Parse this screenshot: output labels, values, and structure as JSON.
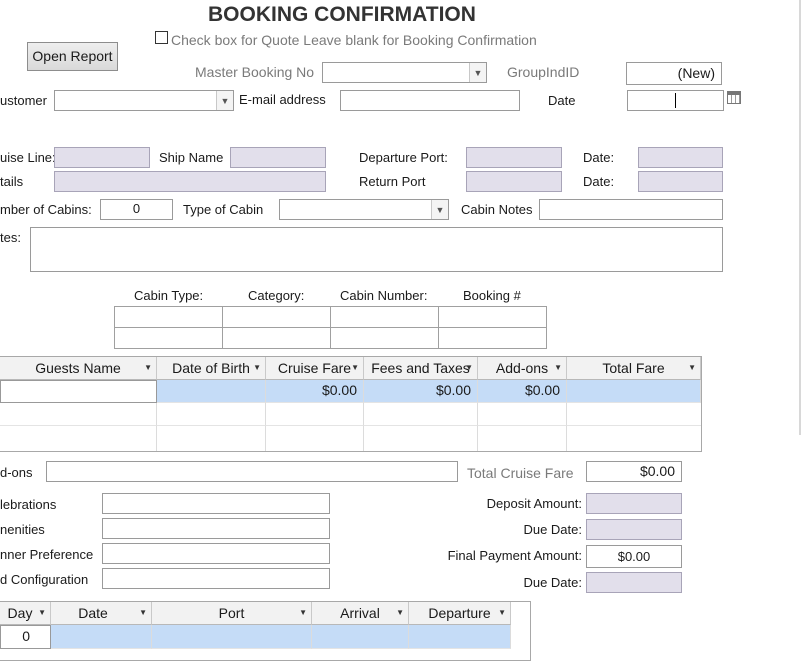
{
  "title": "BOOKING CONFIRMATION",
  "quote_checkbox_label": "Check box for Quote Leave blank for Booking Confirmation",
  "open_report_label": "Open Report",
  "master_booking_label": "Master Booking No",
  "group_id_label": "GroupIndID",
  "group_id_value": "(New)",
  "customer_label": "ustomer",
  "email_label": "E-mail address",
  "date_label": "Date",
  "cruise_line_label": "uise Line:",
  "ship_name_label": "Ship Name",
  "departure_port_label": "Departure Port:",
  "departure_date_label": "Date:",
  "details_label": "tails",
  "return_port_label": "Return Port",
  "return_date_label": "Date:",
  "num_cabins_label": "mber of Cabins:",
  "num_cabins_value": "0",
  "cabin_type_label": "Type of Cabin",
  "cabin_notes_label": "Cabin Notes",
  "notes_label": "tes:",
  "cabin_table": {
    "headers": [
      "Cabin Type:",
      "Category:",
      "Cabin Number:",
      "Booking #"
    ]
  },
  "guests_grid": {
    "headers": [
      "Guests Name",
      "Date of Birth",
      "Cruise Fare",
      "Fees and Taxes",
      "Add-ons",
      "Total Fare"
    ],
    "row1": [
      "",
      "",
      "$0.00",
      "$0.00",
      "$0.00",
      ""
    ]
  },
  "addons_label": "d-ons",
  "total_cruise_fare_label": "Total Cruise Fare",
  "total_cruise_fare_value": "$0.00",
  "celebrations_label": "lebrations",
  "amenities_label": "nenities",
  "dinner_pref_label": "nner Preference",
  "bed_config_label": "d Configuration",
  "deposit_amount_label": "Deposit Amount:",
  "due_date_label_1": "Due Date:",
  "final_payment_label": "Final Payment Amount:",
  "final_payment_value": "$0.00",
  "due_date_label_2": "Due Date:",
  "itinerary_grid": {
    "headers": [
      "Day",
      "Date",
      "Port",
      "Arrival",
      "Departure"
    ],
    "row1_day": "0"
  },
  "colors": {
    "lavender_field": "#e2dfeb",
    "selected_row": "#c5dcf7",
    "grey_label": "#7a7a7a"
  }
}
